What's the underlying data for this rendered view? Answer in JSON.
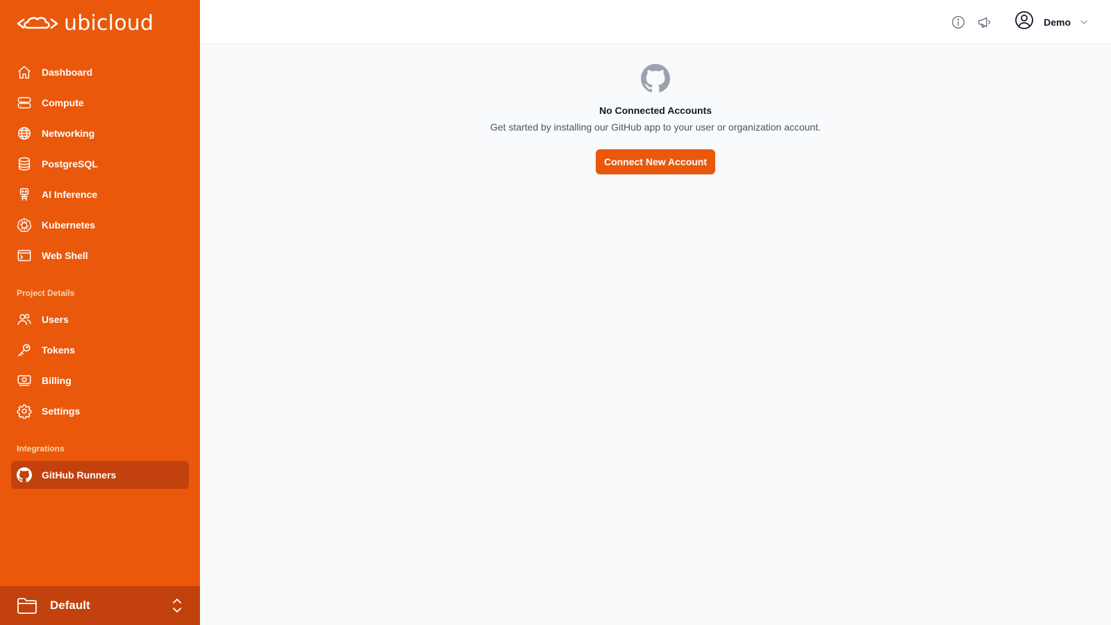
{
  "brand": {
    "name": "ubicloud",
    "accent": "#ea580c",
    "accent_dark": "#c2410c"
  },
  "sidebar": {
    "main_items": [
      {
        "label": "Dashboard",
        "icon": "home-icon"
      },
      {
        "label": "Compute",
        "icon": "server-icon"
      },
      {
        "label": "Networking",
        "icon": "globe-icon"
      },
      {
        "label": "PostgreSQL",
        "icon": "database-icon"
      },
      {
        "label": "AI Inference",
        "icon": "robot-icon"
      },
      {
        "label": "Kubernetes",
        "icon": "kubernetes-icon"
      },
      {
        "label": "Web Shell",
        "icon": "terminal-icon"
      }
    ],
    "project_section": "Project Details",
    "project_items": [
      {
        "label": "Users",
        "icon": "users-icon"
      },
      {
        "label": "Tokens",
        "icon": "key-icon"
      },
      {
        "label": "Billing",
        "icon": "banknote-icon"
      },
      {
        "label": "Settings",
        "icon": "gear-icon"
      }
    ],
    "integrations_section": "Integrations",
    "integration_items": [
      {
        "label": "GitHub Runners",
        "icon": "github-icon",
        "active": true
      }
    ],
    "project_switcher": {
      "name": "Default"
    }
  },
  "topbar": {
    "user": "Demo"
  },
  "empty_state": {
    "title": "No Connected Accounts",
    "description": "Get started by installing our GitHub app to your user or organization account.",
    "button": "Connect New Account"
  }
}
